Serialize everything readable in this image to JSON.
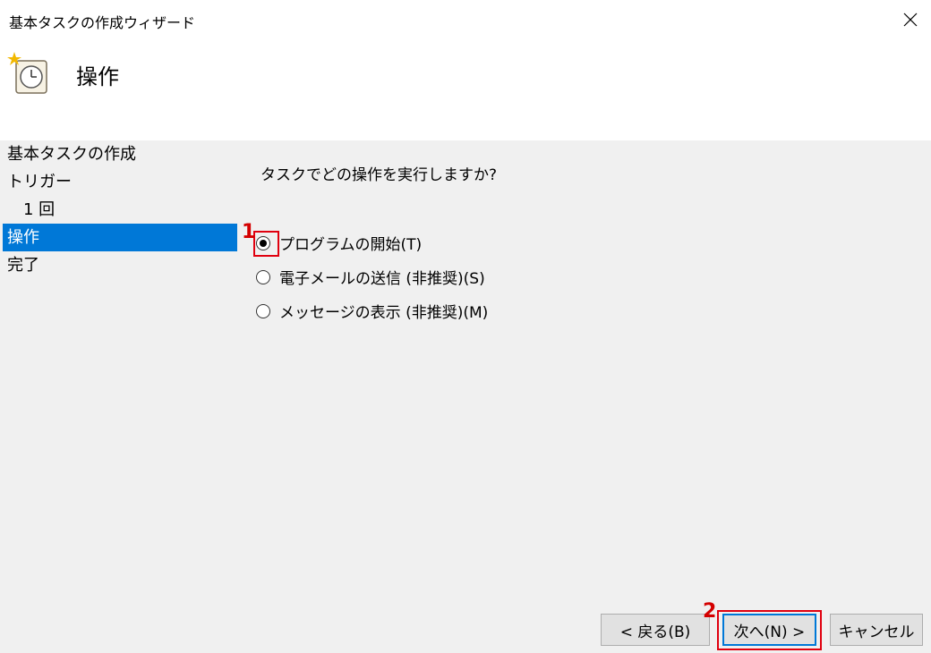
{
  "window": {
    "title": "基本タスクの作成ウィザード"
  },
  "header": {
    "title": "操作",
    "icon": "clock-icon"
  },
  "steps": [
    {
      "label": "基本タスクの作成"
    },
    {
      "label": "トリガー"
    },
    {
      "label": "1 回"
    },
    {
      "label": "操作"
    },
    {
      "label": "完了"
    }
  ],
  "content": {
    "question": "タスクでどの操作を実行しますか?",
    "options": [
      {
        "label": "プログラムの開始(T)",
        "checked": true
      },
      {
        "label": "電子メールの送信 (非推奨)(S)",
        "checked": false
      },
      {
        "label": "メッセージの表示 (非推奨)(M)",
        "checked": false
      }
    ]
  },
  "annotations": {
    "marker1": "1",
    "marker2": "2",
    "color": "#e0000f"
  },
  "buttons": {
    "back": "< 戻る(B)",
    "next": "次へ(N) >",
    "cancel": "キャンセル"
  },
  "colors": {
    "accent": "#0078d7",
    "panel": "#f0f0f0"
  }
}
